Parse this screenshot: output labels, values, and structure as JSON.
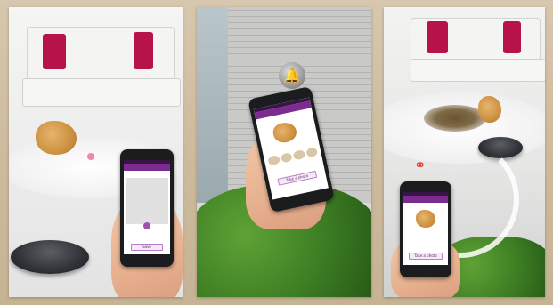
{
  "panels": [
    {
      "id": "living-room-scene",
      "phone": {
        "screen_button_label": "Save"
      }
    },
    {
      "id": "notification-scene",
      "phone": {
        "screen_button_label": "Take a photo"
      }
    },
    {
      "id": "monitoring-scene",
      "phone": {
        "screen_button_label": "Take a photo"
      }
    }
  ],
  "icons": {
    "bell": "bell-icon",
    "wifi": "wifi-icon"
  },
  "colors": {
    "pillow": "#b7134a",
    "app_purple": "#7a2c8f",
    "wifi_red": "#e8332a",
    "hedge_green": "#3a7a22"
  }
}
